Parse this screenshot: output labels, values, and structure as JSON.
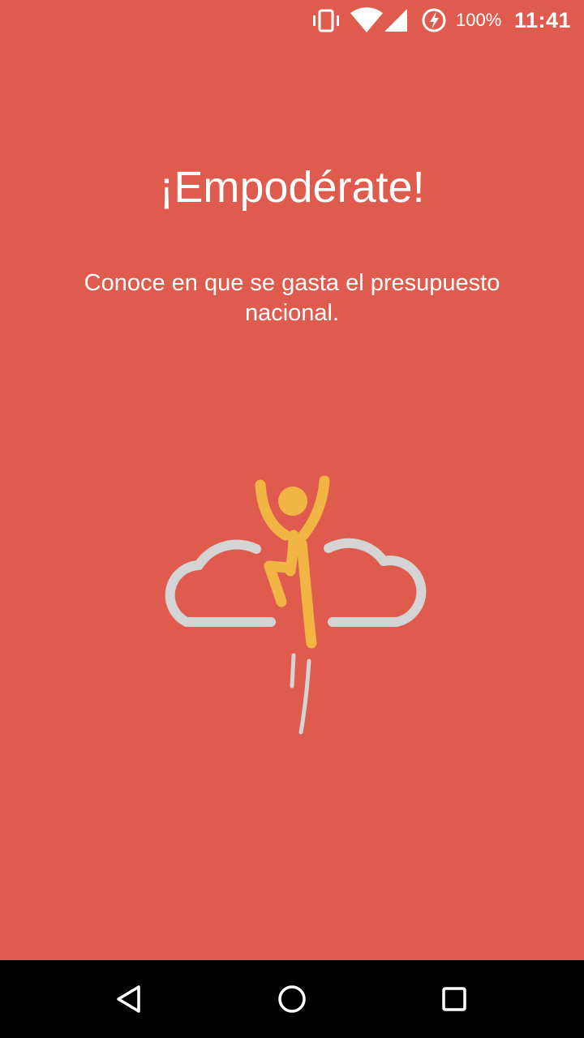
{
  "status_bar": {
    "battery_percent": "100%",
    "time": "11:41",
    "icons": [
      "vibrate-icon",
      "wifi-icon",
      "cell-signal-icon",
      "battery-charging-icon"
    ]
  },
  "onboarding": {
    "title": "¡Empodérate!",
    "subtitle": "Conoce en que se gasta el presupuesto nacional.",
    "illustration": "person-jumping-through-clouds-icon"
  },
  "nav_bar": {
    "buttons": [
      "back-icon",
      "home-icon",
      "recents-icon"
    ]
  },
  "colors": {
    "background": "#df5b4d",
    "figure": "#f2b543",
    "cloud": "#d4d4d4",
    "text": "#ffffff"
  }
}
